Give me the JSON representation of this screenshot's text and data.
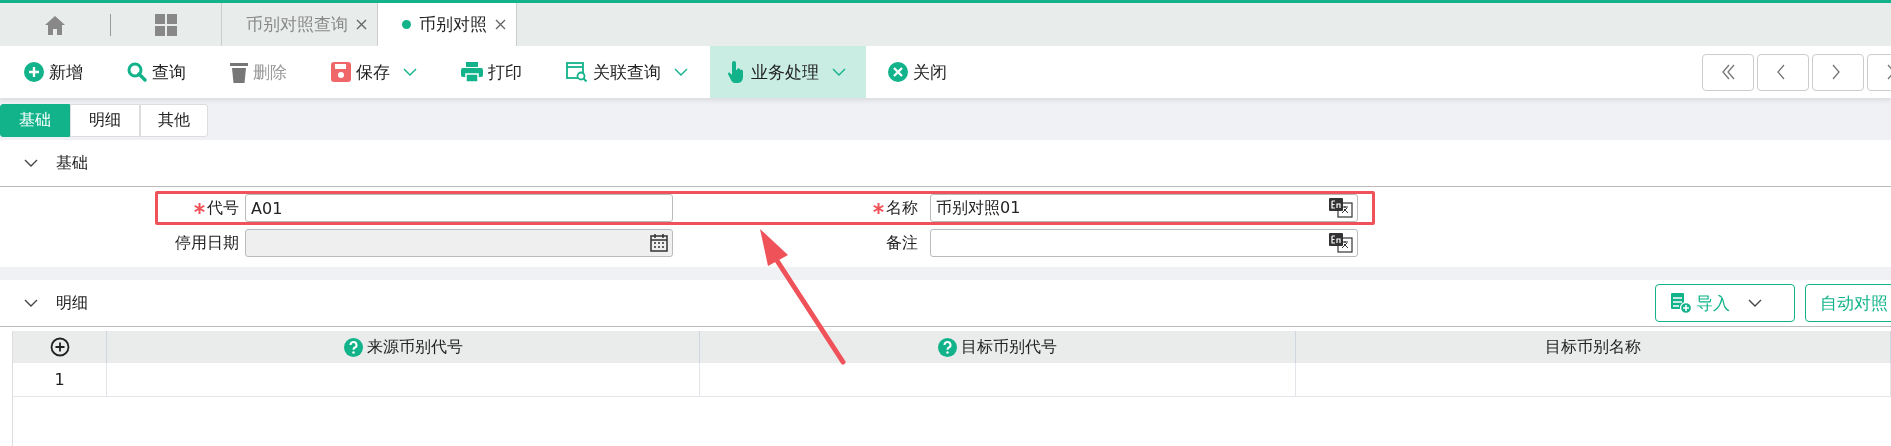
{
  "top_tabs": [
    {
      "label": "币别对照查询",
      "selected": false
    },
    {
      "label": "币别对照",
      "selected": true
    }
  ],
  "toolbar": [
    {
      "label": "新增",
      "kind": "add",
      "disabled": false,
      "dropdown": false,
      "highlighted": false
    },
    {
      "label": "查询",
      "kind": "search",
      "disabled": false,
      "dropdown": false,
      "highlighted": false
    },
    {
      "label": "删除",
      "kind": "delete",
      "disabled": true,
      "dropdown": false,
      "highlighted": false
    },
    {
      "label": "保存",
      "kind": "save",
      "disabled": false,
      "dropdown": true,
      "highlighted": false
    },
    {
      "label": "打印",
      "kind": "print",
      "disabled": false,
      "dropdown": false,
      "highlighted": false
    },
    {
      "label": "关联查询",
      "kind": "linked-query",
      "disabled": false,
      "dropdown": true,
      "highlighted": false
    },
    {
      "label": "业务处理",
      "kind": "process",
      "disabled": false,
      "dropdown": true,
      "highlighted": true
    },
    {
      "label": "关闭",
      "kind": "close",
      "disabled": false,
      "dropdown": false,
      "highlighted": false
    }
  ],
  "sub_tabs": [
    {
      "label": "基础",
      "selected": true
    },
    {
      "label": "明细",
      "selected": false
    },
    {
      "label": "其他",
      "selected": false
    }
  ],
  "basic_section": {
    "title": "基础",
    "expanded": true,
    "arrow": true,
    "rows": [
      {
        "highlighted": true,
        "fields": [
          {
            "label": "代号",
            "required": true,
            "value": "A01",
            "kind": "text",
            "disabled": false
          },
          {
            "label": "名称",
            "required": true,
            "value": "币别对照01",
            "kind": "translatable",
            "disabled": false
          }
        ]
      },
      {
        "highlighted": false,
        "fields": [
          {
            "label": "停用日期",
            "required": false,
            "kind": "date",
            "disabled": true
          },
          {
            "label": "备注",
            "required": false,
            "kind": "translatable",
            "disabled": false
          }
        ]
      }
    ]
  },
  "detail_section": {
    "title": "明细",
    "expanded": true,
    "buttons": [
      {
        "label": "导入",
        "kind": "import",
        "dropdown": true
      },
      {
        "label": "自动对照",
        "kind": "plain",
        "dropdown": false
      }
    ],
    "table": {
      "columns": [
        {
          "label": "来源币别代号",
          "help": true
        },
        {
          "label": "目标币别代号",
          "help": true
        },
        {
          "label": "目标币别名称",
          "help": false
        }
      ],
      "rows": [
        {
          "number": "1"
        }
      ]
    }
  }
}
